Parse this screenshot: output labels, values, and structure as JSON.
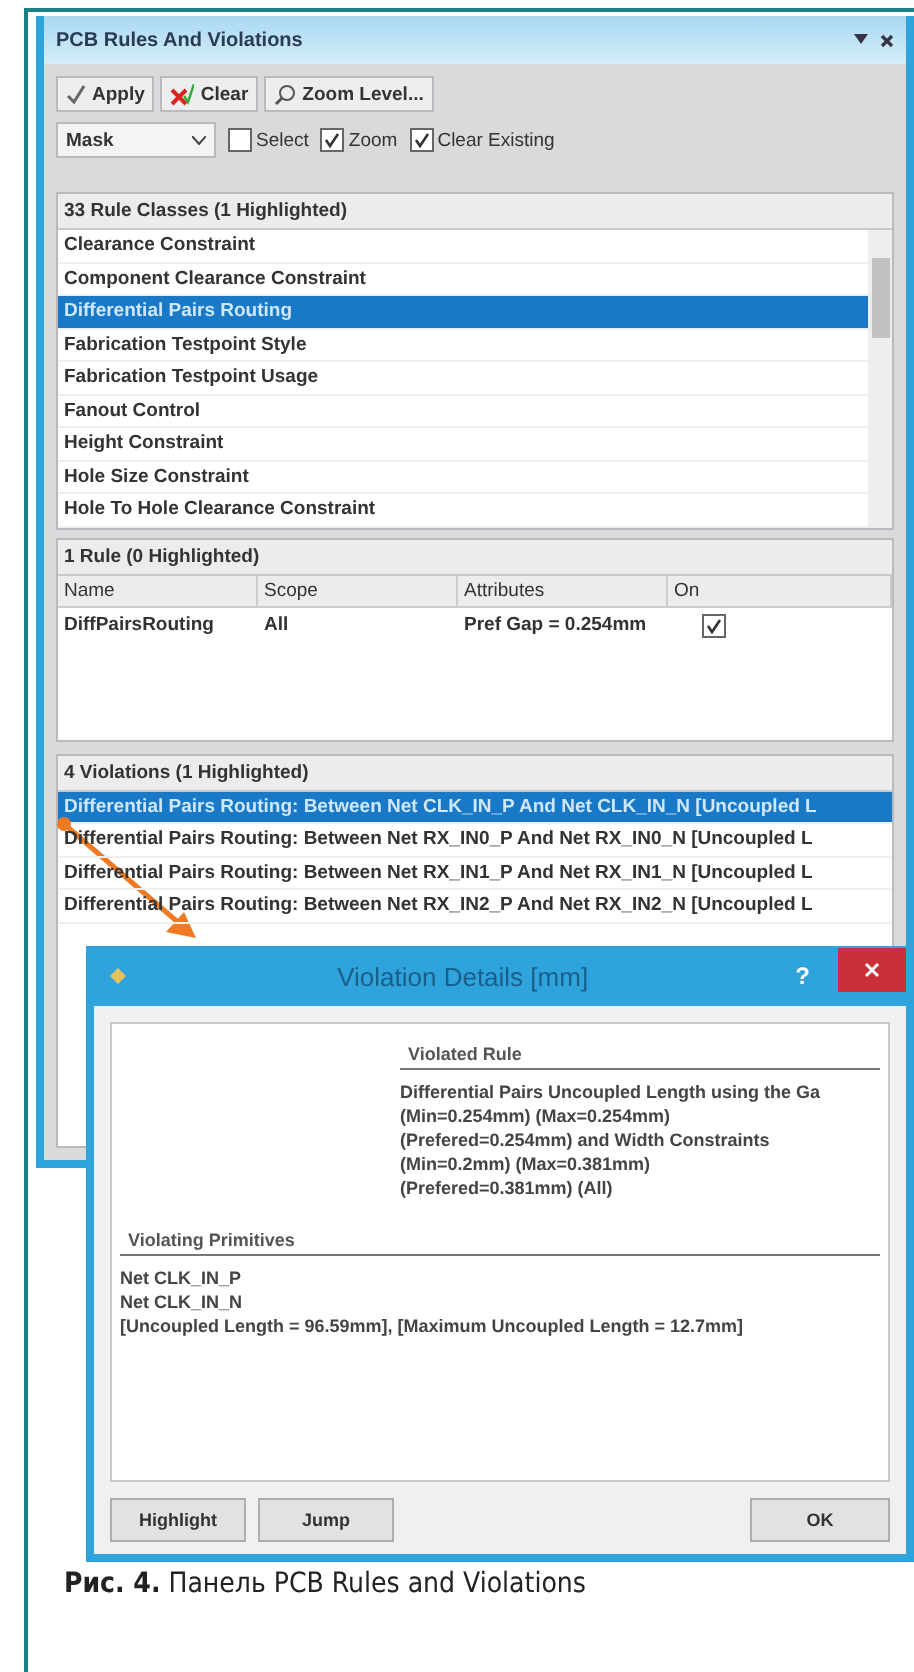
{
  "panel": {
    "title": "PCB Rules And Violations",
    "toolbar": [
      {
        "kind": "apply",
        "label": "Apply"
      },
      {
        "kind": "clear",
        "label": "Clear"
      },
      {
        "kind": "zoom",
        "label": "Zoom Level..."
      }
    ],
    "mask_select": {
      "value": "Mask"
    },
    "options": [
      {
        "label": "Select",
        "checked": false
      },
      {
        "label": "Zoom",
        "checked": true
      },
      {
        "label": "Clear Existing",
        "checked": true
      }
    ],
    "rule_classes": {
      "header": "33 Rule Classes (1 Highlighted)",
      "items": [
        {
          "label": "Clearance Constraint",
          "selected": false
        },
        {
          "label": "Component Clearance Constraint",
          "selected": false
        },
        {
          "label": "Differential Pairs Routing",
          "selected": true
        },
        {
          "label": "Fabrication Testpoint Style",
          "selected": false
        },
        {
          "label": "Fabrication Testpoint Usage",
          "selected": false
        },
        {
          "label": "Fanout Control",
          "selected": false
        },
        {
          "label": "Height Constraint",
          "selected": false
        },
        {
          "label": "Hole Size Constraint",
          "selected": false
        },
        {
          "label": "Hole To Hole Clearance Constraint",
          "selected": false
        }
      ]
    },
    "rules": {
      "header": "1 Rule (0 Highlighted)",
      "columns": [
        "Name",
        "Scope",
        "Attributes",
        "On"
      ],
      "rows": [
        {
          "name": "DiffPairsRouting",
          "scope": "All",
          "attributes": "Pref Gap = 0.254mm",
          "on": true
        }
      ]
    },
    "violations": {
      "header": "4 Violations (1 Highlighted)",
      "items": [
        {
          "label": "Differential Pairs Routing: Between Net CLK_IN_P And Net CLK_IN_N [Uncoupled L",
          "selected": true
        },
        {
          "label": "Differential Pairs Routing: Between Net RX_IN0_P And Net RX_IN0_N [Uncoupled L",
          "selected": false
        },
        {
          "label": "Differential Pairs Routing: Between Net RX_IN1_P And Net RX_IN1_N [Uncoupled L",
          "selected": false
        },
        {
          "label": "Differential Pairs Routing: Between Net RX_IN2_P And Net RX_IN2_N [Uncoupled L",
          "selected": false
        }
      ]
    }
  },
  "dialog": {
    "title": "Violation Details [mm]",
    "help": "?",
    "violated_rule": {
      "heading": "Violated Rule",
      "lines": [
        "Differential Pairs Uncoupled Length using the Ga",
        "(Min=0.254mm) (Max=0.254mm)",
        "(Prefered=0.254mm)  and Width Constraints",
        "(Min=0.2mm) (Max=0.381mm)",
        "(Prefered=0.381mm) (All)"
      ]
    },
    "primitives": {
      "heading": "Violating Primitives",
      "lines": [
        "Net CLK_IN_P",
        "Net CLK_IN_N",
        "[Uncoupled Length = 96.59mm], [Maximum Uncoupled Length = 12.7mm]"
      ]
    },
    "buttons": [
      "Highlight",
      "Jump"
    ],
    "ok": "OK"
  },
  "caption": "**Рис. 4.** Панель PCB Rules and Violations"
}
